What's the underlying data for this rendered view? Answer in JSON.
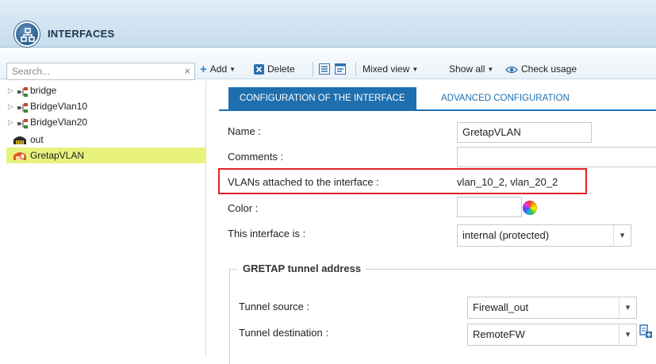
{
  "header": {
    "title": "INTERFACES",
    "icon": "network-icon"
  },
  "toolbar": {
    "search_placeholder": "Search...",
    "clear": "×",
    "add": "Add",
    "delete": "Delete",
    "mixed_view": "Mixed view",
    "show_all": "Show all",
    "check_usage": "Check usage"
  },
  "tree": {
    "items": [
      {
        "label": "bridge",
        "expandable": true
      },
      {
        "label": "BridgeVlan10",
        "expandable": true
      },
      {
        "label": "BridgeVlan20",
        "expandable": true
      },
      {
        "label": "out",
        "expandable": false
      },
      {
        "label": "GretapVLAN",
        "expandable": false,
        "selected": true
      }
    ]
  },
  "tabs": [
    {
      "label": "CONFIGURATION OF THE INTERFACE",
      "active": true
    },
    {
      "label": "ADVANCED CONFIGURATION",
      "active": false
    }
  ],
  "form": {
    "name_label": "Name :",
    "name_value": "GretapVLAN",
    "comments_label": "Comments :",
    "comments_value": "",
    "vlans_label": "VLANs attached to the interface :",
    "vlans_value": "vlan_10_2, vlan_20_2",
    "color_label": "Color :",
    "interface_is_label": "This interface is :",
    "interface_is_value": "internal (protected)",
    "gretap_section": "GRETAP tunnel address",
    "tunnel_source_label": "Tunnel source :",
    "tunnel_source_value": "Firewall_out",
    "tunnel_dest_label": "Tunnel destination :",
    "tunnel_dest_value": "RemoteFW"
  },
  "colors": {
    "accent": "#1f6fae",
    "selection": "#e7f37d",
    "highlight_border": "#e3202a"
  }
}
